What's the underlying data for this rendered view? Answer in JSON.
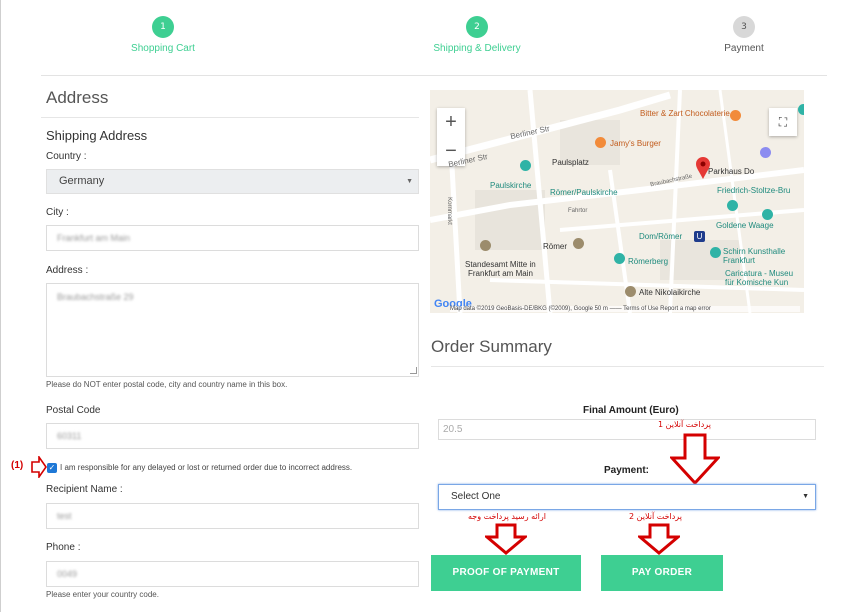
{
  "stepper": {
    "steps": [
      {
        "num": "1",
        "label": "Shopping Cart"
      },
      {
        "num": "2",
        "label": "Shipping & Delivery"
      },
      {
        "num": "3",
        "label": "Payment"
      }
    ]
  },
  "address": {
    "heading": "Address",
    "shipping_heading": "Shipping Address",
    "country_label": "Country :",
    "country_value": "Germany",
    "city_label": "City :",
    "city_value": "Frankfurt am Main",
    "address_label": "Address :",
    "address_value": "Braubachstraße 29",
    "address_note": "Please do NOT enter postal code, city and country name in this box.",
    "postal_label": "Postal Code",
    "postal_value": "60311",
    "checkbox_label": "I am responsible for any delayed or lost or returned order due to incorrect address.",
    "recipient_label": "Recipient Name :",
    "recipient_value": "test",
    "phone_label": "Phone :",
    "phone_value": "0049",
    "phone_note": "Please enter your country code."
  },
  "annotations": {
    "marker_1": "(1)",
    "online_payment_1": "پرداخت آنلاین 1",
    "online_payment_2": "پرداخت آنلاین 2",
    "receipt_upload": "ارائه رسید پرداخت وجه"
  },
  "map": {
    "zoom_in": "+",
    "zoom_out": "−",
    "fullscreen": "⛶",
    "labels": {
      "bitter": "Bitter & Zart Chocolaterie",
      "jamys": "Jamy's Burger",
      "paulsplatz": "Paulsplatz",
      "paulskirche": "Paulskirche",
      "roemer_paulskirche": "Römer/Paulskirche",
      "berliner": "Berliner Str",
      "berliner2": "Berliner Str",
      "parkhaus": "Parkhaus Do",
      "stoltze": "Friedrich-Stoltze-Bru",
      "goldene": "Goldene Waage",
      "domroemer": "Dom/Römer",
      "schirn": "Schirn Kunsthalle",
      "frankfurt": "Frankfurt",
      "caricatura": "Caricatura - Museu",
      "komische": "für Komische Kun",
      "roemer": "Römer",
      "standesamt": "Standesamt Mitte in",
      "frankfurtmain": "Frankfurt am Main",
      "roemerberg": "Römerberg",
      "nikolai": "Alte Nikolaikirche",
      "kornmarkt": "Kornmarkt",
      "braubach": "Braubachstraße",
      "fahrtor": "Fahrtor"
    },
    "credit": "Map data ©2019 GeoBasis-DE/BKG (©2009), Google   50 m ——     Terms of Use   Report a map error",
    "google": "Google"
  },
  "order": {
    "heading": "Order Summary",
    "final_amount_label": "Final Amount (Euro)",
    "final_amount_value": "20.5",
    "payment_label": "Payment:",
    "payment_value": "Select One",
    "proof_button": "PROOF OF PAYMENT",
    "pay_button": "PAY ORDER"
  },
  "colors": {
    "accent": "#3ecf92",
    "annotation_red": "#d40000"
  }
}
